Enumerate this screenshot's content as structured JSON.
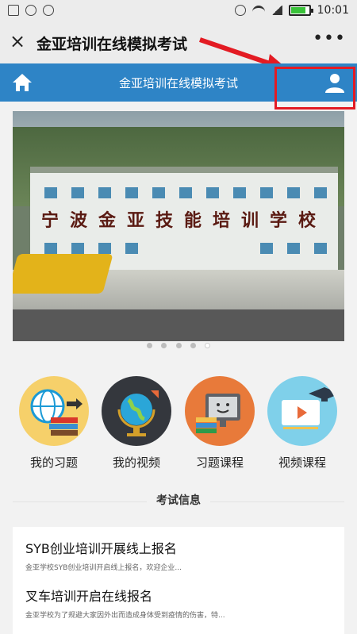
{
  "status": {
    "time": "10:01"
  },
  "wechat": {
    "close": "×",
    "title": "金亚培训在线模拟考试",
    "more": "•••"
  },
  "appbar": {
    "title": "金亚培训在线模拟考试"
  },
  "menu": [
    {
      "label": "我的习题",
      "icon": "globe-books-icon"
    },
    {
      "label": "我的视频",
      "icon": "globe-icon"
    },
    {
      "label": "习题课程",
      "icon": "monitor-smile-icon"
    },
    {
      "label": "视频课程",
      "icon": "video-graduation-icon"
    }
  ],
  "section": {
    "title": "考试信息"
  },
  "news": [
    {
      "title": "SYB创业培训开展线上报名",
      "desc": "金亚学校SYB创业培训开启线上报名，欢迎企业..."
    },
    {
      "title": "叉车培训开启在线报名",
      "desc": "金亚学校为了规避大家因外出而造成身体受到疫情的伤害，特..."
    }
  ],
  "banner": {
    "sign": "宁波金亚技能培训学校"
  }
}
